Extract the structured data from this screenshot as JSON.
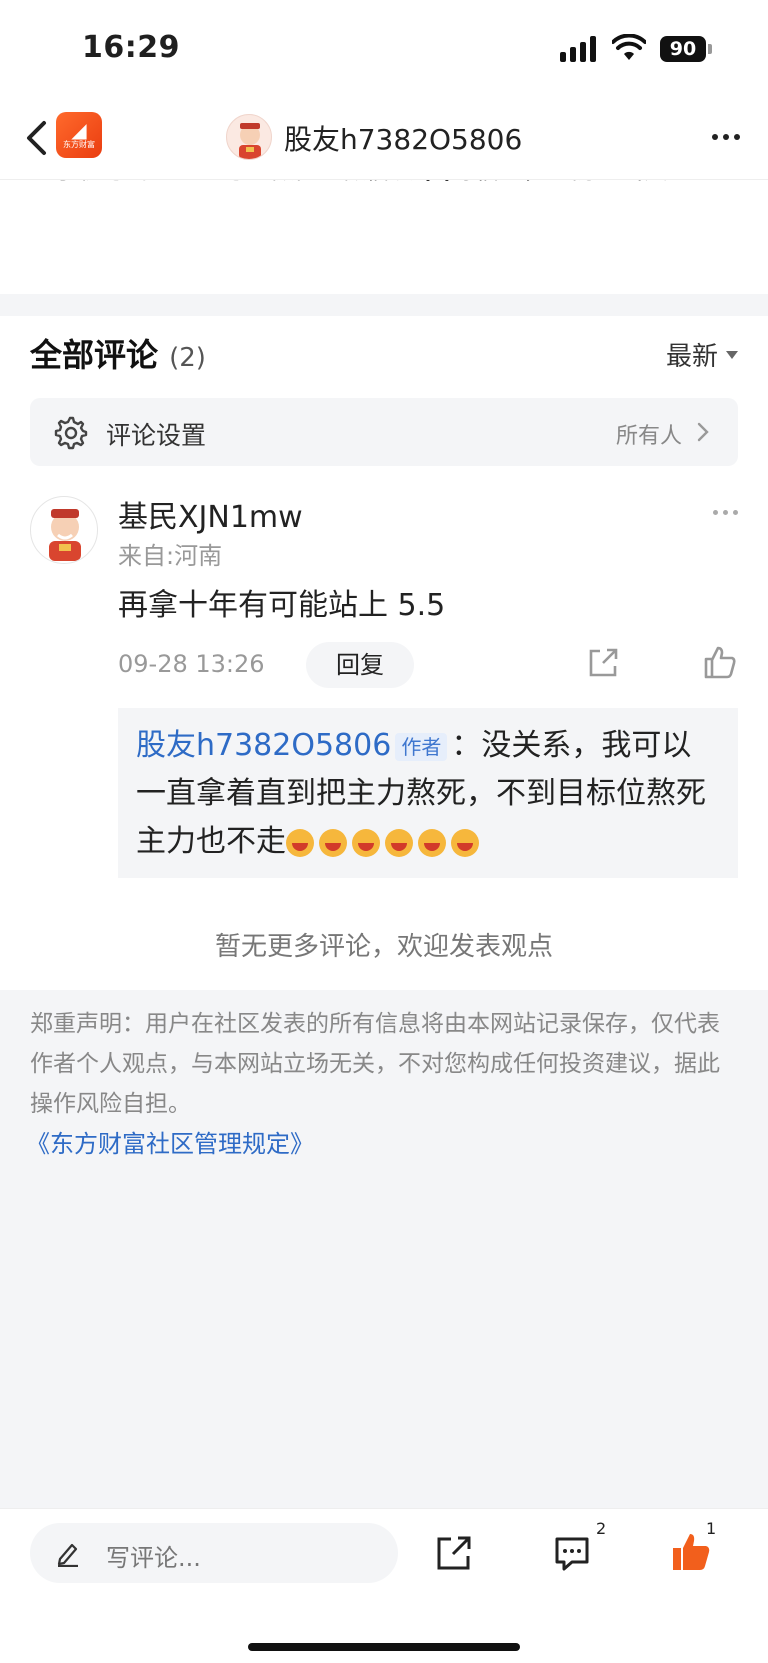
{
  "status_bar": {
    "time": "16:29",
    "battery": "90"
  },
  "nav": {
    "title": "股友h7382O5806",
    "logo_text": "东方财富"
  },
  "warning": {
    "lines": "…号码、公众号、微博、微信及QQ等信息，谨防上当受骗！",
    "visible_text": "的手机号码、公众号、微博、微信及QQ等信息，谨防上当受骗！"
  },
  "comments": {
    "title": "全部评论",
    "count": "(2)",
    "sort_label": "最新"
  },
  "settings": {
    "label": "评论设置",
    "value": "所有人"
  },
  "comment": {
    "username": "基民XJN1mw",
    "location": "来自:河南",
    "text": "再拿十年有可能站上 5.5",
    "time": "09-28 13:26",
    "reply_button": "回复",
    "reply": {
      "author": "股友h7382O5806",
      "author_tag": "作者",
      "separator": "：",
      "text": "没关系，我可以一直拿着直到把主力熬死，不到目标位熬死主力也不走"
    }
  },
  "no_more_text": "暂无更多评论，欢迎发表观点",
  "disclaimer": {
    "text": "郑重声明：用户在社区发表的所有信息将由本网站记录保存，仅代表作者个人观点，与本网站立场无关，不对您构成任何投资建议，据此操作风险自担。",
    "link": "《东方财富社区管理规定》"
  },
  "bottom_bar": {
    "input_placeholder": "写评论...",
    "comment_count": "2",
    "like_count": "1"
  },
  "colors": {
    "accent": "#2e6bc6",
    "brand": "#ff5a1f",
    "background_gray": "#f4f5f7"
  },
  "icons": [
    "back-icon",
    "app-logo-icon",
    "avatar-icon",
    "more-icon",
    "gear-icon",
    "chevron-right-icon",
    "share-icon",
    "thumbs-up-icon",
    "pen-icon",
    "comment-icon",
    "laugh-emoji-icon"
  ]
}
